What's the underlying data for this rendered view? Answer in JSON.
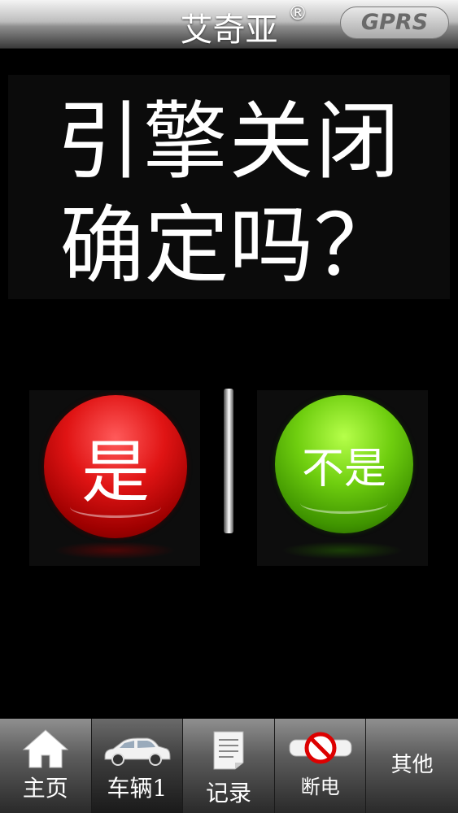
{
  "header": {
    "brand": "艾奇亚",
    "brand_mark": "®",
    "network_badge": "GPRS"
  },
  "prompt": {
    "line1": "引擎关闭",
    "line2": "确定吗？"
  },
  "actions": {
    "yes_label": "是",
    "no_label": "不是"
  },
  "colors": {
    "yes_button": "#e01414",
    "no_button": "#6fce0f",
    "background": "#000000"
  },
  "bottom_nav": {
    "items": [
      {
        "label": "主页",
        "icon": "home-icon"
      },
      {
        "label": "车辆1",
        "icon": "car-icon"
      },
      {
        "label": "记录",
        "icon": "document-icon"
      },
      {
        "label": "断电",
        "icon": "power-cut-icon"
      },
      {
        "label": "其他",
        "icon": ""
      }
    ]
  }
}
